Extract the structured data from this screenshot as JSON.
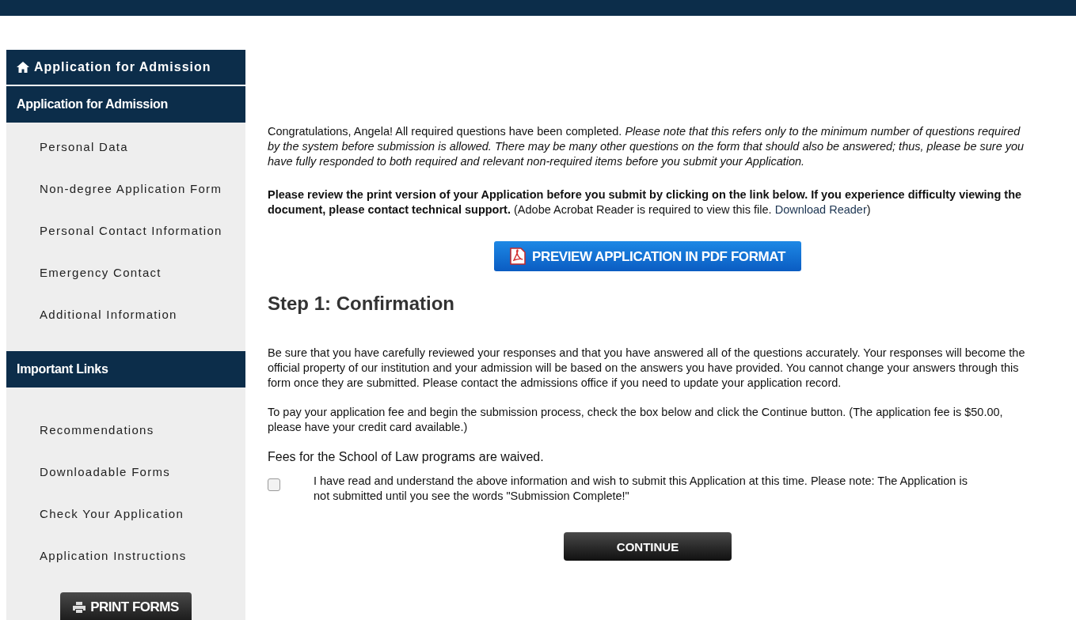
{
  "sidebar": {
    "home_header": "Application for Admission",
    "sections": [
      {
        "title": "Application for Admission",
        "items": [
          "Personal Data",
          "Non-degree Application Form",
          "Personal Contact Information",
          "Emergency Contact",
          "Additional Information"
        ]
      },
      {
        "title": "Important Links",
        "items": [
          "Recommendations",
          "Downloadable Forms",
          "Check Your Application",
          "Application Instructions"
        ]
      }
    ],
    "print_button": "PRINT FORMS"
  },
  "main": {
    "intro": "Congratulations, Angela! All required questions have been completed. *Please note that this refers only to the minimum number of questions required by the system before submission is allowed. There may be many other questions on the form that should also be answered; thus, please be sure you have fully responded to both required and relevant non-required items before you submit your Application.*",
    "review_note": {
      "before": "**Please review the print version of your Application before you submit by clicking on the link below. If you experience difficulty viewing the document, please contact technical support.** (Adobe Acrobat Reader is required to view this file.",
      "link": "Download Reader",
      "after": ")"
    },
    "preview_button": "PREVIEW APPLICATION IN PDF FORMAT",
    "step_title": "Step 1: Confirmation",
    "paragraphs": [
      "Be sure that you have carefully reviewed your responses and that you have answered all of the questions accurately. Your responses will become the official property of our institution and your admission will be based on the answers you have provided. You cannot change your answers through this form once they are submitted. Please contact the admissions office if you need to update your application record.",
      "To pay your application fee and begin the submission process, check the box below and click the Continue button. (The application fee is $50.00, please have your credit card available.)"
    ],
    "fees_note": "Fees for the School of Law programs are waived.",
    "agreement": {
      "checked": false,
      "label": "I have read and understand the above information and wish to submit this Application at this time. Please note: The Application is not submitted until you see the words \"Submission Complete!\""
    },
    "continue_button": "CONTINUE"
  }
}
